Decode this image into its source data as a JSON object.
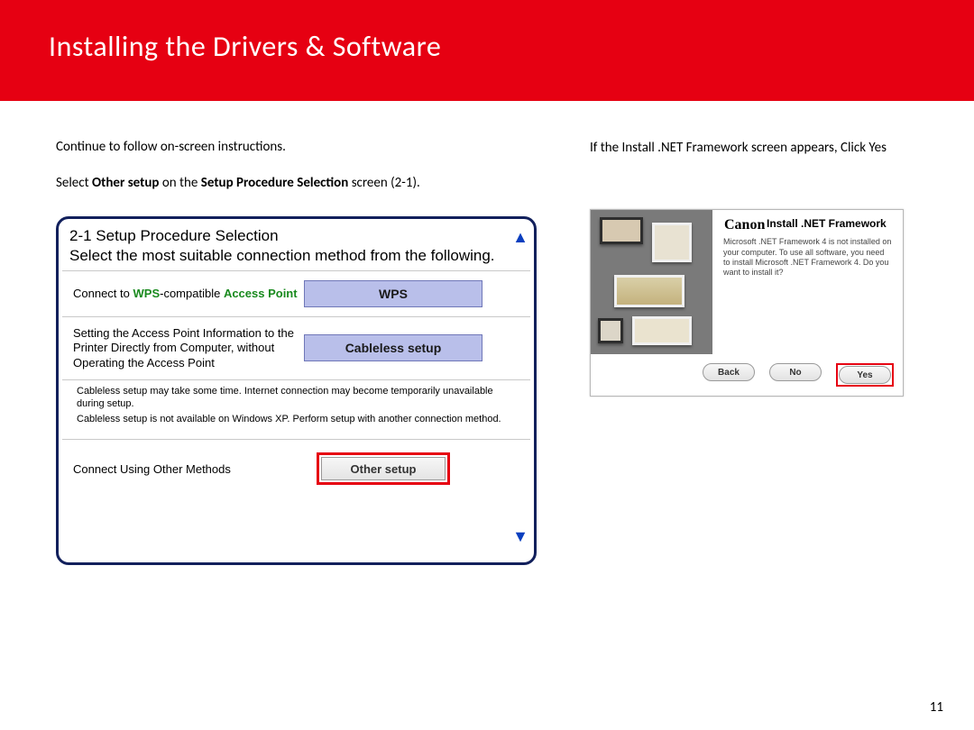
{
  "page": {
    "title": "Installing  the Drivers & Software",
    "number": "11"
  },
  "left": {
    "line1": "Continue to follow on-screen instructions.",
    "line2_pre": "Select ",
    "line2_b1": "Other setup",
    "line2_mid": " on the ",
    "line2_b2": "Setup Procedure Selection",
    "line2_post": " screen (2-1)."
  },
  "sps": {
    "title": "2-1 Setup Procedure Selection",
    "subtitle": "Select the most suitable connection method from the following.",
    "row1_pre": "Connect to ",
    "row1_green1": "WPS",
    "row1_mid": "-compatible ",
    "row1_green2": "Access Point",
    "btn_wps": "WPS",
    "row2_desc": "Setting the Access Point Information to the Printer Directly from Computer, without Operating the Access Point",
    "btn_cableless": "Cableless setup",
    "note1": "Cableless setup may take some time. Internet connection may become temporarily unavailable during setup.",
    "note2": "Cableless setup is not available on Windows XP. Perform setup with another connection method.",
    "row3_desc": "Connect Using Other Methods",
    "btn_other": "Other setup"
  },
  "right": {
    "instr": "If the Install .NET Framework screen appears, Click Yes"
  },
  "net": {
    "logo": "Canon",
    "title": "Install .NET Framework",
    "text": "Microsoft .NET Framework 4 is not installed on your computer. To use all software, you need to install Microsoft .NET Framework 4. Do you want to install it?",
    "back": "Back",
    "no": "No",
    "yes": "Yes"
  }
}
